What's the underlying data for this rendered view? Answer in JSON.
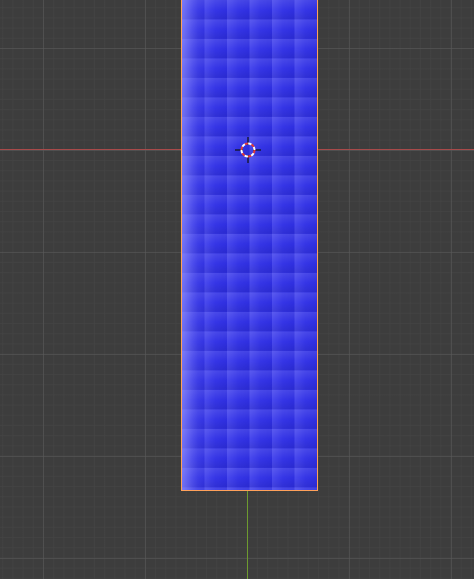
{
  "viewport": {
    "background": "#3d3d3d",
    "grid_color": "#5a5a5a"
  },
  "axes": {
    "x_axis_color": "#a84a4a",
    "y_axis_color": "#6d9a2f"
  },
  "mesh": {
    "color": "#3535e6",
    "outline_color": "#ffa15a",
    "selected": true
  },
  "cursor": {
    "icon": "3d-cursor-icon",
    "ring_colors": [
      "#e23b3b",
      "#ffffff"
    ],
    "crosshair_color": "#111111"
  }
}
